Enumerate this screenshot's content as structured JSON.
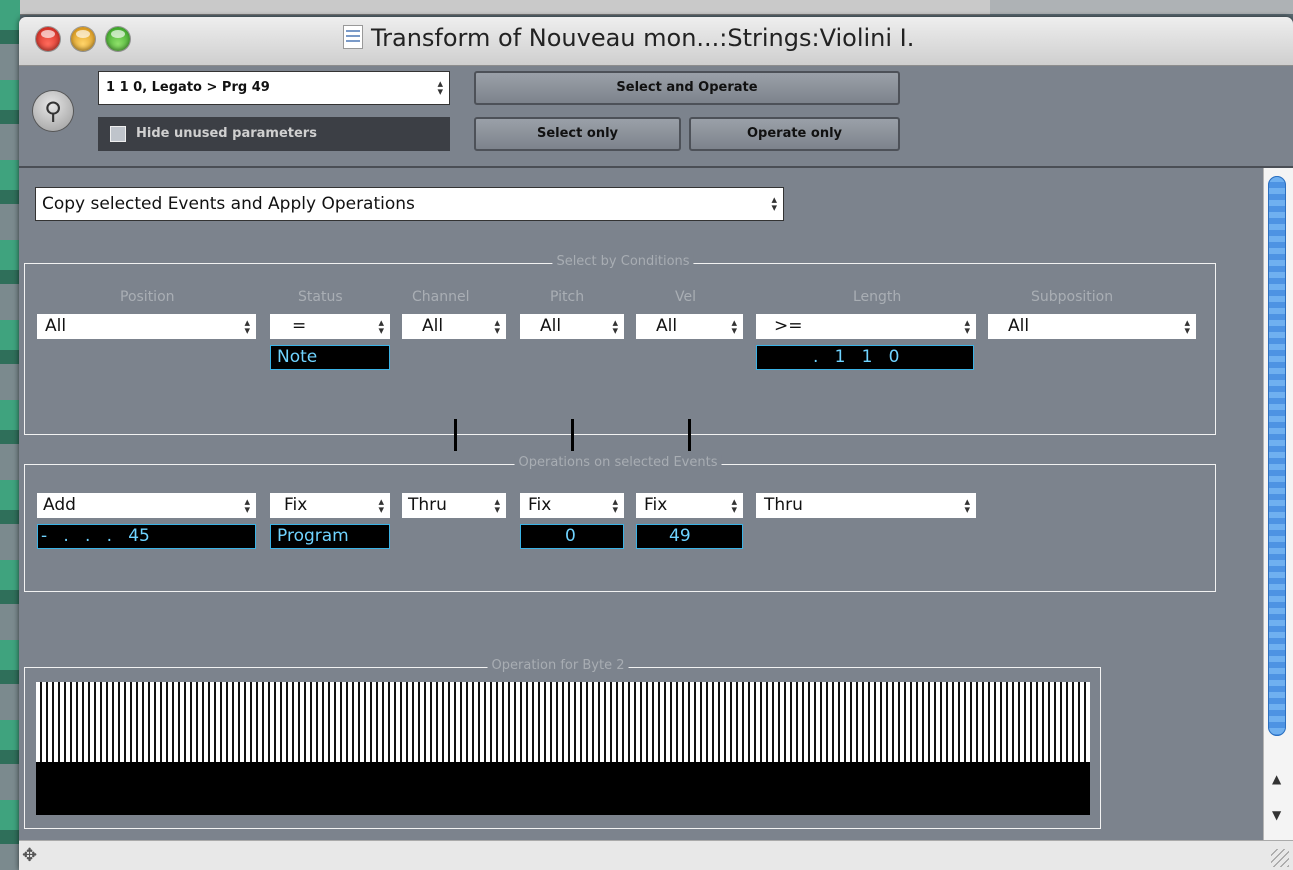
{
  "window": {
    "title": "Transform of Nouveau mon...:Strings:Violini I."
  },
  "toolbar": {
    "preset": "1 1 0,  Legato > Prg 49",
    "hide_unused_label": "Hide unused parameters",
    "hide_unused_checked": false,
    "select_and_operate": "Select and Operate",
    "select_only": "Select only",
    "operate_only": "Operate only"
  },
  "mode": {
    "value": "Copy selected Events and Apply Operations"
  },
  "conditions": {
    "title": "Select by Conditions",
    "columns": {
      "position": "Position",
      "status": "Status",
      "channel": "Channel",
      "pitch": "Pitch",
      "vel": "Vel",
      "length": "Length",
      "subposition": "Subposition"
    },
    "selects": {
      "position": "All",
      "status": "=",
      "channel": "All",
      "pitch": "All",
      "vel": "All",
      "length": ">=",
      "subposition": "All"
    },
    "values": {
      "status": "Note",
      "length": ".   1   1   0"
    }
  },
  "operations": {
    "title": "Operations on selected Events",
    "selects": {
      "position": "Add",
      "status": "Fix",
      "channel": "Thru",
      "pitch": "Fix",
      "vel": "Fix",
      "length": "Thru"
    },
    "values": {
      "position": "-   .   .   .   45",
      "status": "Program",
      "pitch": "0",
      "vel": "49"
    }
  },
  "byte2": {
    "title": "Operation for Byte 2"
  },
  "colors": {
    "window_bg": "#7c838d",
    "value_text": "#6fd3ff",
    "value_border": "#3bb3e6",
    "scroll_thumb": "#5b9fe8"
  }
}
